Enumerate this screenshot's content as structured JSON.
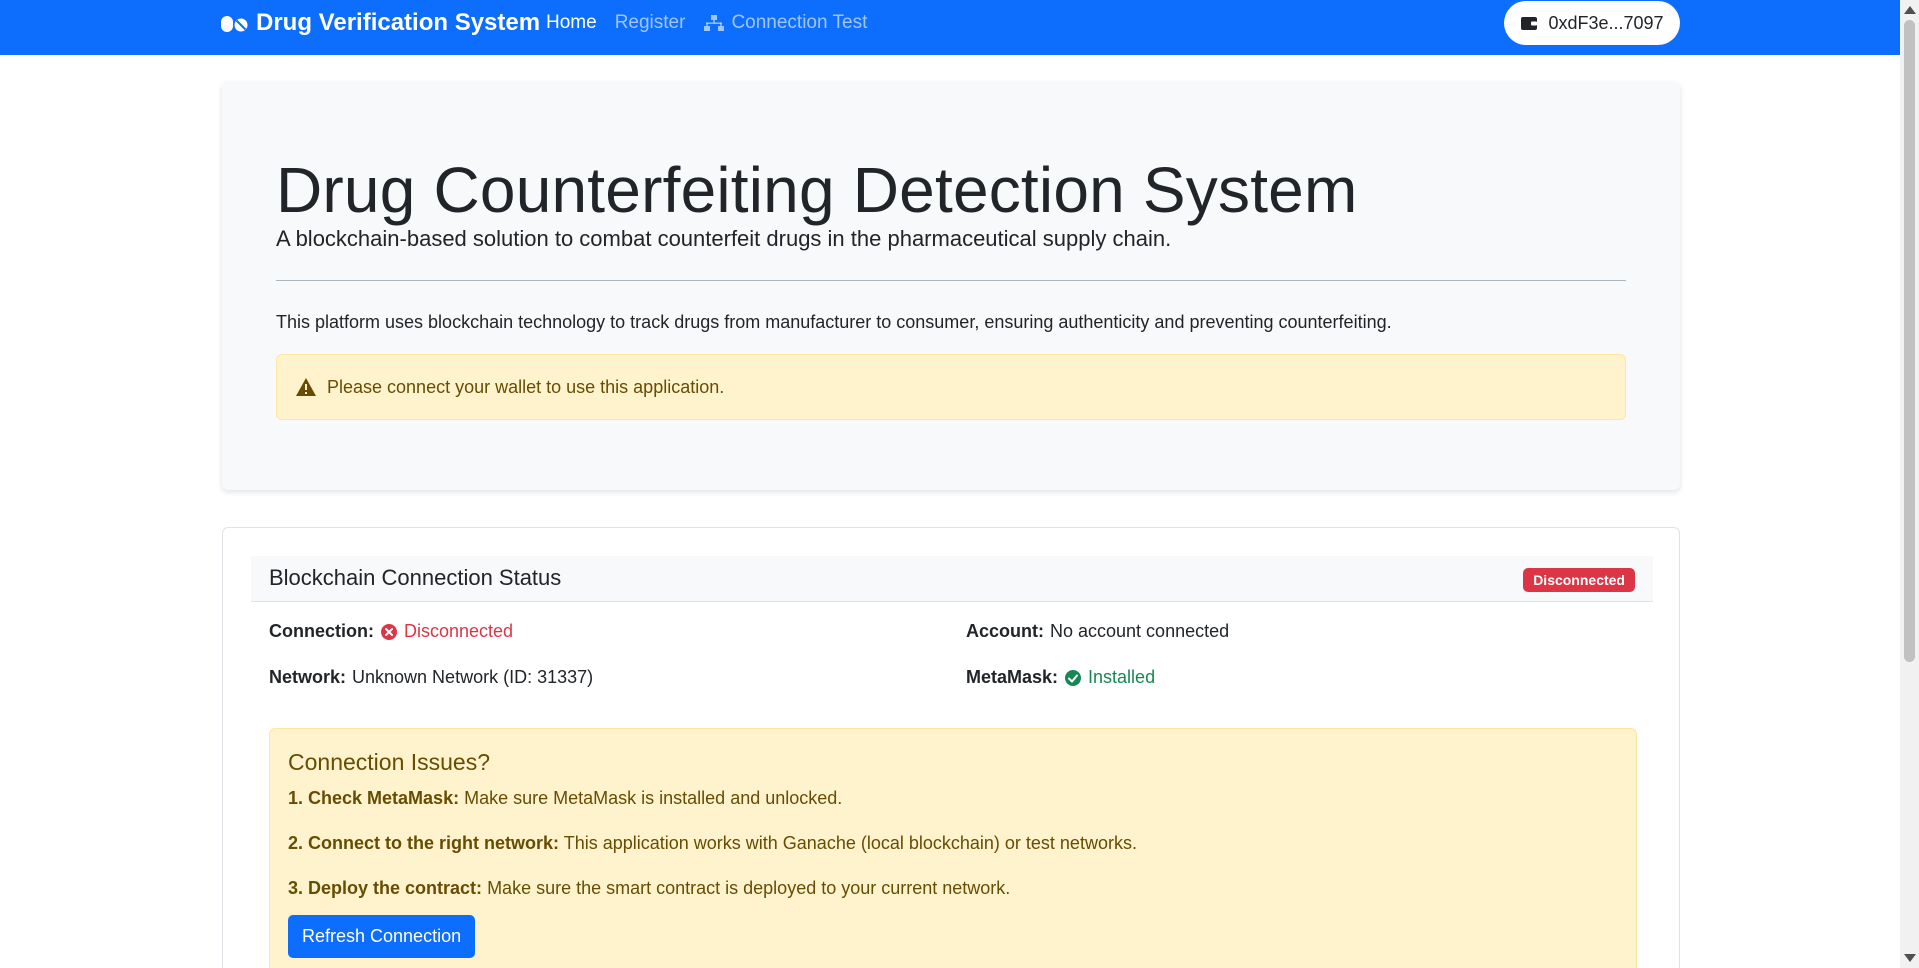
{
  "navbar": {
    "brand": "Drug Verification System",
    "links": [
      {
        "label": "Home",
        "active": true
      },
      {
        "label": "Register",
        "active": false
      },
      {
        "label": "Connection Test",
        "active": false
      }
    ],
    "wallet_address": "0xdF3e...7097"
  },
  "hero": {
    "title": "Drug Counterfeiting Detection System",
    "lead": "A blockchain-based solution to combat counterfeit drugs in the pharmaceutical supply chain.",
    "description": "This platform uses blockchain technology to track drugs from manufacturer to consumer, ensuring authenticity and preventing counterfeiting.",
    "warning": "Please connect your wallet to use this application."
  },
  "status": {
    "title": "Blockchain Connection Status",
    "badge": "Disconnected",
    "connection_label": "Connection:",
    "connection_value": "Disconnected",
    "account_label": "Account:",
    "account_value": "No account connected",
    "network_label": "Network:",
    "network_value": "Unknown Network (ID: 31337)",
    "metamask_label": "MetaMask:",
    "metamask_value": "Installed"
  },
  "issues": {
    "title": "Connection Issues?",
    "items": [
      {
        "label": "1. Check MetaMask:",
        "text": "Make sure MetaMask is installed and unlocked."
      },
      {
        "label": "2. Connect to the right network:",
        "text": "This application works with Ganache (local blockchain) or test networks."
      },
      {
        "label": "3. Deploy the contract:",
        "text": "Make sure the smart contract is deployed to your current network."
      }
    ],
    "refresh_label": "Refresh Connection"
  },
  "colors": {
    "primary": "#0d6efd",
    "danger": "#dc3545",
    "success": "#198754",
    "warning_bg": "#fff3cd",
    "warning_text": "#664d03"
  }
}
